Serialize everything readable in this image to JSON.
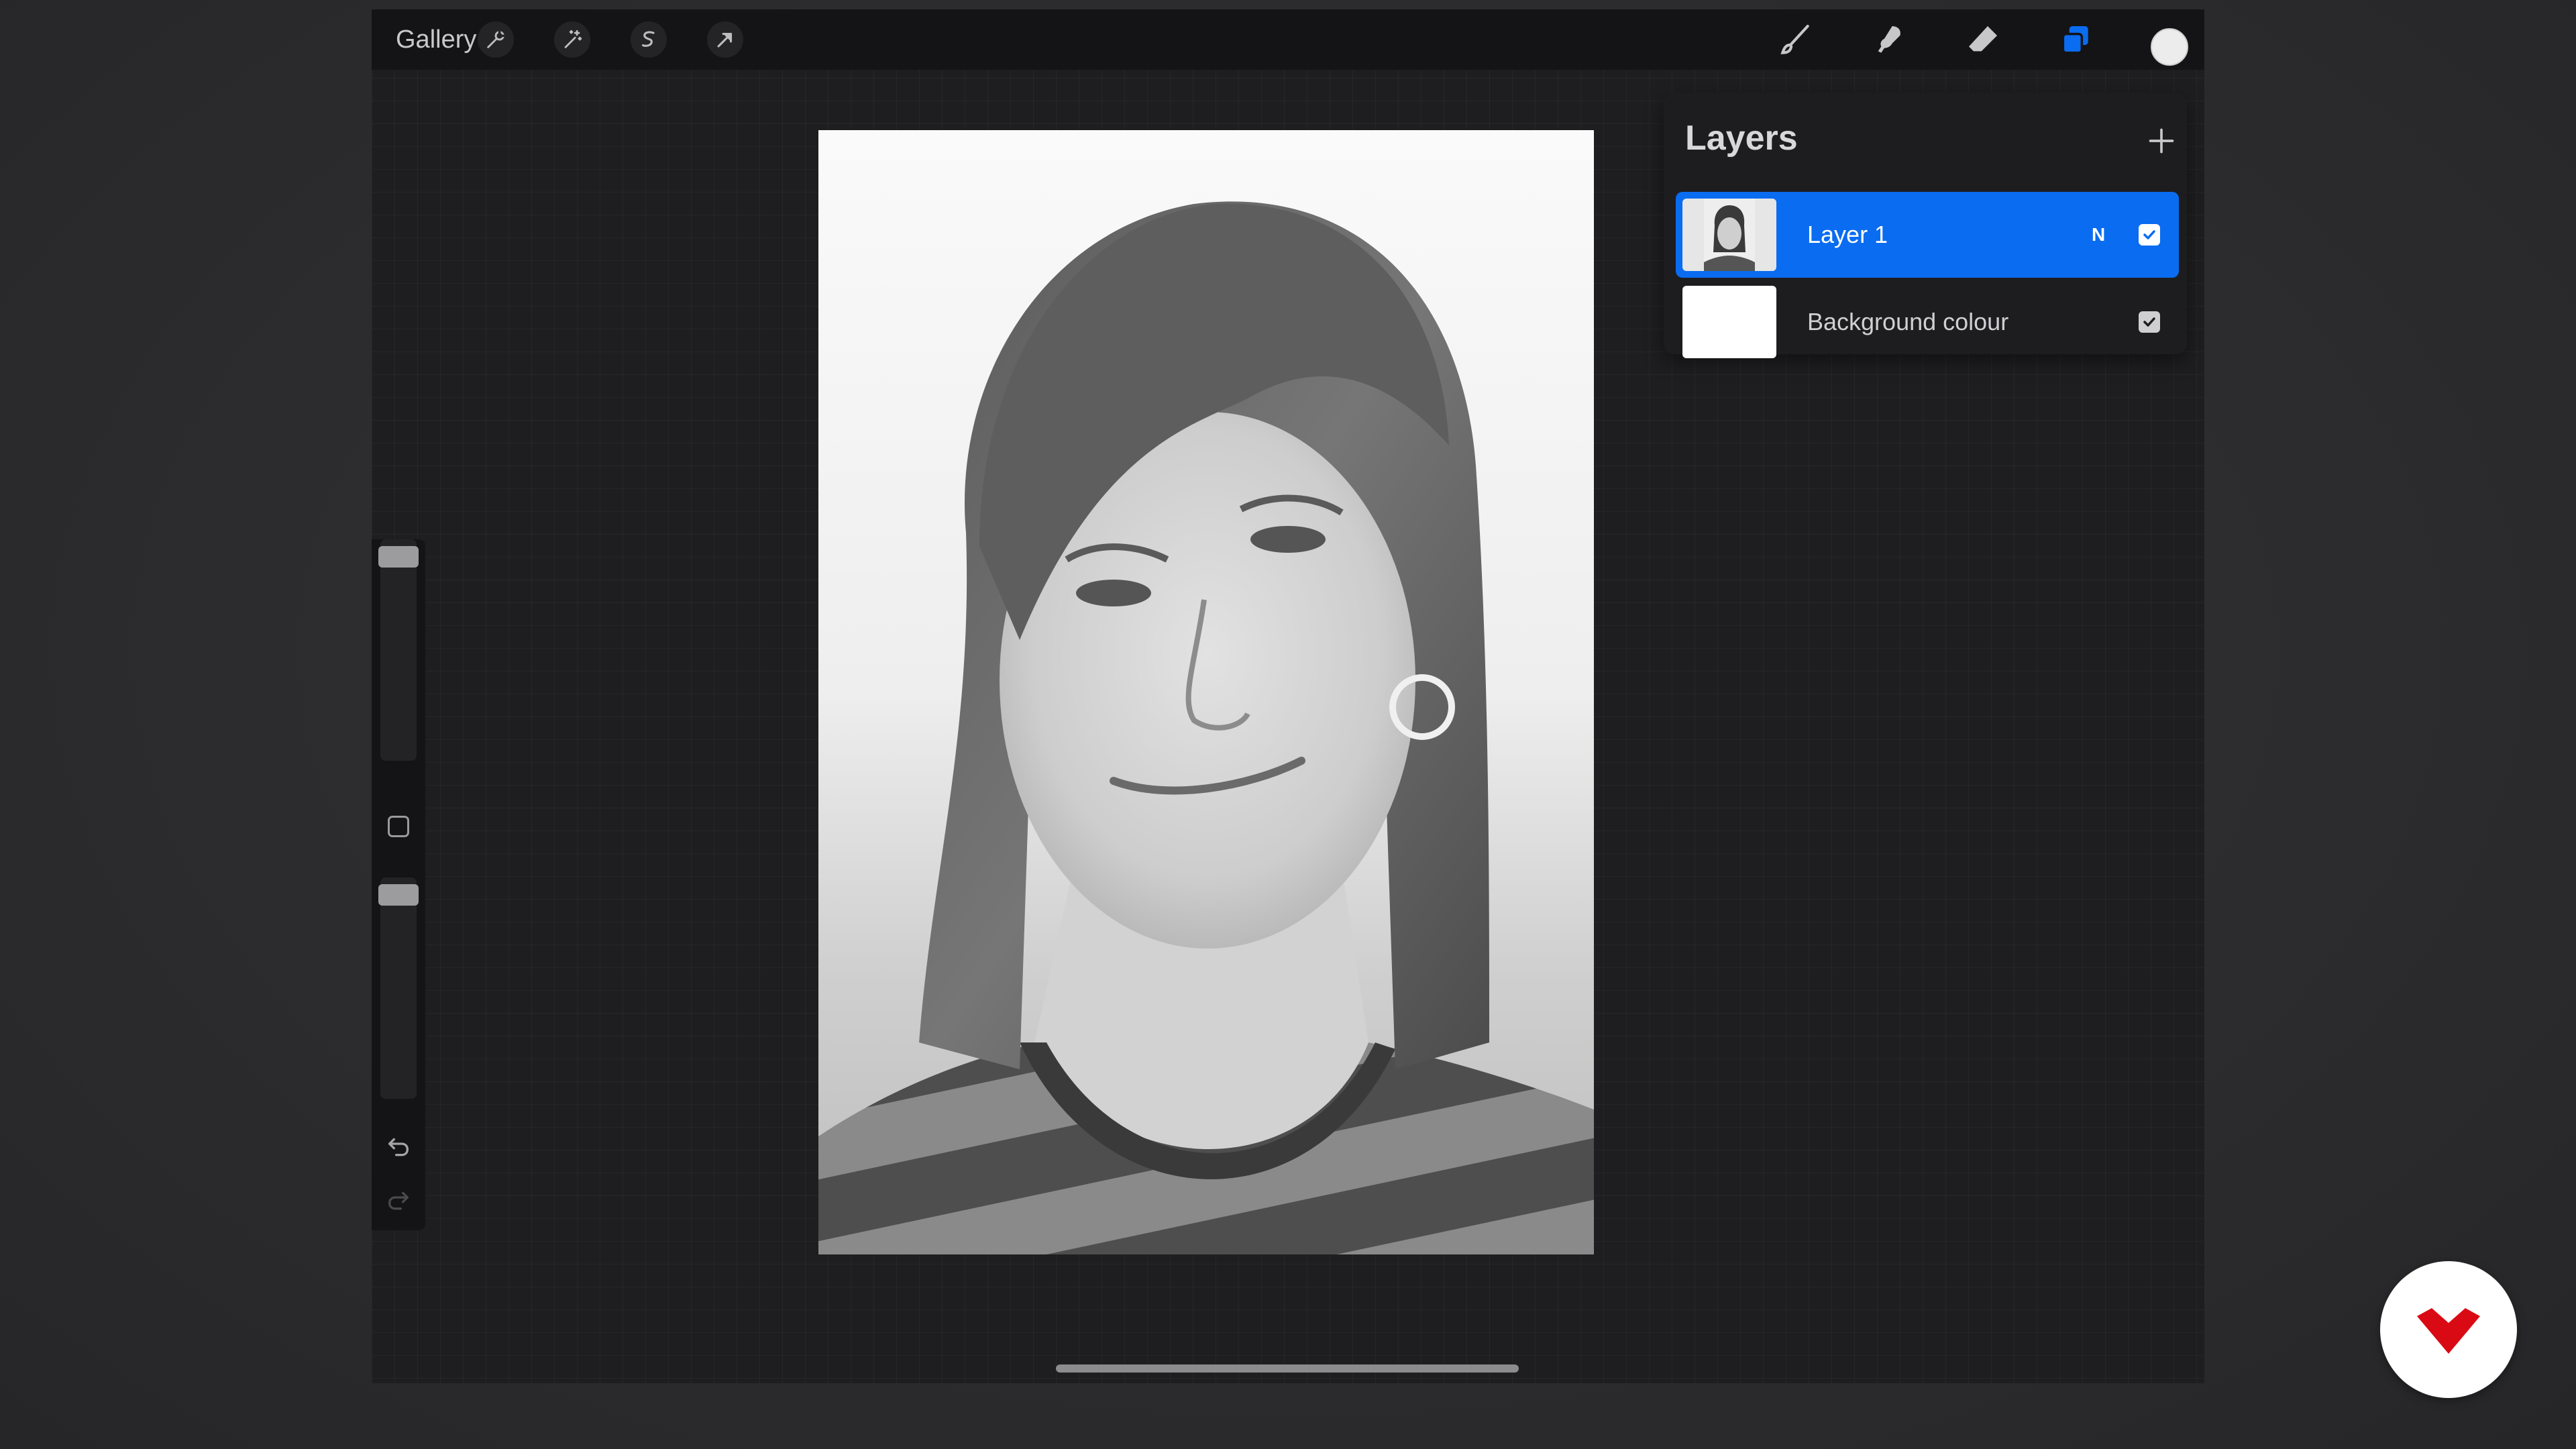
{
  "toolbar": {
    "gallery_label": "Gallery",
    "left_tools": [
      "wrench-icon",
      "magic-wand-icon",
      "selection-icon",
      "transform-arrow-icon"
    ],
    "right_tools": [
      "brush-icon",
      "smudge-icon",
      "eraser-icon",
      "layers-icon"
    ],
    "active_tool": "layers-icon",
    "current_color": "#ececec"
  },
  "layers_panel": {
    "title": "Layers",
    "add_icon": "plus-icon",
    "layers": [
      {
        "name": "Layer 1",
        "blend_mode": "N",
        "visible": true,
        "selected": true
      },
      {
        "name": "Background colour",
        "visible": true,
        "selected": false
      }
    ]
  },
  "sidebar": {
    "brush_size_level": 0,
    "opacity_level": 0,
    "icons": [
      "modify-square-icon",
      "undo-icon",
      "redo-icon"
    ]
  },
  "colors": {
    "accent": "#0a6cf0",
    "toolbar_bg": "#141416",
    "screen_bg": "#1e1e20",
    "logo_red": "#d90a14"
  }
}
